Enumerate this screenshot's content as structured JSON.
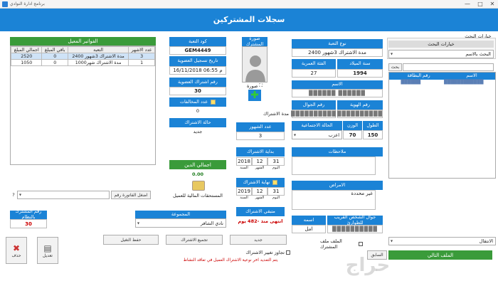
{
  "window": {
    "title": "برنامج ادارة النوادي",
    "header": "سجلات المشتركين",
    "min": "—",
    "max": "□",
    "close": "✕"
  },
  "bills": {
    "title": "الفواتير المعيل",
    "headers": [
      "اجمالي المبلغ",
      "باقي المبلغ",
      "التعبة",
      "عدد الاشهر"
    ],
    "rows": [
      [
        "2520",
        "0",
        "مدة الاشتراك 3شهور 2400",
        "3"
      ],
      [
        "1050",
        "0",
        "مدة الاشتراك شهر1000",
        "1"
      ]
    ]
  },
  "card": {
    "type_label": "كود التعبة",
    "type_value": "GEM4449",
    "reg_date_label": "تاريخ تسجيل العضوية",
    "reg_date_value": "16/11/2018 06:55 م",
    "membership_no_label": "رقم اشتراك العضوية",
    "membership_no_value": "30",
    "violations_label": "عدد المخالفات",
    "violations_value": "0",
    "status_label": "حالة الاشتراك",
    "status_value": "جديد"
  },
  "total": {
    "label": "اجمالي الدين",
    "value": "0.00"
  },
  "bill_no_btn": "اضغل الفاتورة رقم",
  "bill_combo_value": "",
  "overdue": "المستحقات المالية للعميل",
  "photo": {
    "label": "صورة المشترك",
    "caption": "صورة",
    "subscription_period": "مدة الاشتراك"
  },
  "months": {
    "label": "عدد الشهور",
    "value": "3"
  },
  "start": {
    "label": "بداية الاشتراك",
    "day": "31",
    "month": "12",
    "year": "2018",
    "day_l": "اليوم",
    "month_l": "الشهر",
    "year_l": "السنة"
  },
  "end": {
    "label": "نهاية الاشتراك",
    "day": "31",
    "month": "12",
    "year": "2019",
    "day_l": "اليوم",
    "month_l": "الشهر",
    "year_l": "السنة"
  },
  "remaining": {
    "label": "متبقي الاشتراك",
    "value": "انتهى منذ -482 يوم"
  },
  "form": {
    "package_label": "نوع التعبة",
    "package_value": "مدة الاشتراك 3شهور 2400",
    "birth_label": "سنة الميلاد",
    "birth_value": "1994",
    "age_label": "الفئة العمرية",
    "age_value": "27",
    "name_label": "الاسم",
    "name_value": "██████ ██████",
    "id_label": "رقم الهوية",
    "id_value": "██████████",
    "mobile_label": "رقم الجوال",
    "mobile_value": "██████████",
    "height_label": "الطول",
    "height_value": "150",
    "weight_label": "الوزن",
    "weight_value": "70",
    "social_label": "الحالة الاجتماعية",
    "social_value": "اعزب",
    "notes_label": "ملاحظات",
    "notes_value": "",
    "diseases_label": "الامراض",
    "diseases_value": "غير محددة",
    "emergency_label": "جوال الشخص القريب للطوارئ",
    "emergency_name_label": "اسمه",
    "emergency_name_value": "امل",
    "emergency_phone_value": "██████████"
  },
  "search": {
    "options_label": "خيارات البحث",
    "box_label": "خيارات البحث",
    "by_value": "البحث بالاسم",
    "input": "",
    "search_btn": "بحث",
    "col_name": "الاسم",
    "col_card": "رقم البطاقة",
    "row_name": "████████████",
    "row_card": "██████"
  },
  "subscriber_no": {
    "label": "رقم المشترك بالنظام",
    "value": "30"
  },
  "group": {
    "label": "المجموعة",
    "value": "نادي الشافر"
  },
  "buttons": {
    "save": "حفظ التغيل",
    "renew": "تجميع الاشتراك",
    "new": "جديد",
    "del": "حذف",
    "edit": "تعديل",
    "check": "تجاوز تغيير الاشتراك",
    "warn": "يتم التعديد اخر نوعية الاشتراك العميل في تعاقد النشاط",
    "toggle": "الملف ملف المشترك",
    "next_label": "الانتقال",
    "next_btn": "الملف التالي",
    "prev": "السابق"
  },
  "watermark": "حراج"
}
